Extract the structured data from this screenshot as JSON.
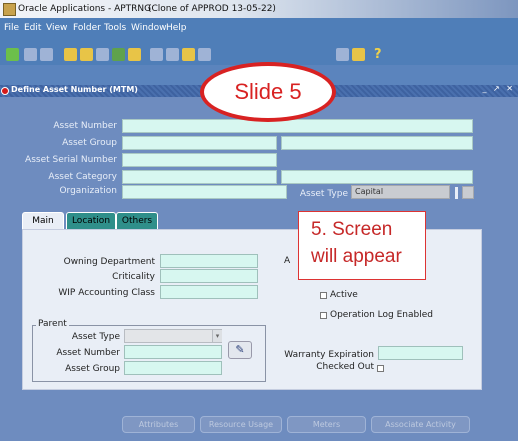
{
  "window": {
    "title": "Oracle Applications - APTRNG",
    "subtitle": "(Clone of APPROD 13-05-22)"
  },
  "menu": [
    "File",
    "Edit",
    "View",
    "Folder",
    "Tools",
    "Window",
    "Help"
  ],
  "form": {
    "title": "Define Asset Number (MTM)"
  },
  "header_fields": {
    "asset_number_label": "Asset Number",
    "asset_group_label": "Asset Group",
    "asset_serial_label": "Asset Serial Number",
    "asset_category_label": "Asset Category",
    "organization_label": "Organization",
    "asset_type_label": "Asset Type",
    "asset_type_value": "Capital"
  },
  "tabs": [
    "Main",
    "Location",
    "Others"
  ],
  "main_tab": {
    "owning_department_label": "Owning Department",
    "criticality_label": "Criticality",
    "wip_accounting_label": "WIP Accounting Class",
    "partial_label": "A",
    "active_label": "Active",
    "operation_log_label": "Operation Log Enabled",
    "parent_group_label": "Parent",
    "parent_asset_type_label": "Asset Type",
    "parent_asset_number_label": "Asset  Number",
    "parent_asset_group_label": "Asset Group",
    "warranty_label": "Warranty Expiration",
    "checked_out_label": "Checked Out"
  },
  "buttons": [
    "Attributes",
    "Resource Usage",
    "Meters",
    "Associate Activity"
  ],
  "callouts": {
    "slide": "Slide 5",
    "note_line1": "5. Screen",
    "note_line2": "will appear"
  },
  "colors": {
    "form_bg": "#6e8cbf",
    "field_bg": "#d7f7f0",
    "callout_red": "#d82222"
  }
}
